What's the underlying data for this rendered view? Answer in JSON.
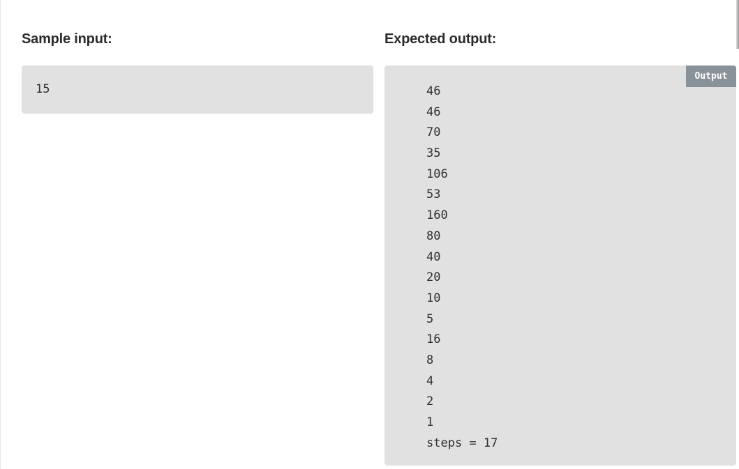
{
  "sample_input": {
    "heading": "Sample input:",
    "lines": [
      "15"
    ]
  },
  "expected_output": {
    "heading": "Expected output:",
    "badge": "Output",
    "lines": [
      "46",
      "46",
      "70",
      "35",
      "106",
      "53",
      "160",
      "80",
      "40",
      "20",
      "10",
      "5",
      "16",
      "8",
      "4",
      "2",
      "1",
      "steps = 17"
    ]
  }
}
